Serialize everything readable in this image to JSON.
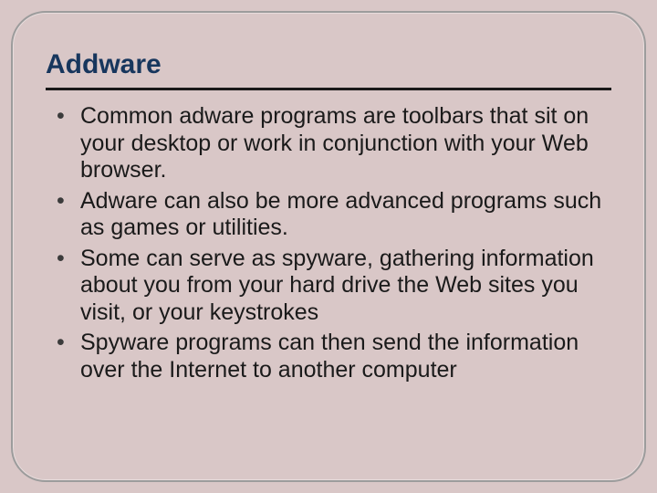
{
  "slide": {
    "title": "Addware",
    "bullets": [
      "Common adware programs are toolbars that sit on your desktop or work in conjunction with your Web browser.",
      "Adware can also be more advanced programs such as games or utilities.",
      "Some can serve as spyware, gathering information about you from your hard drive the Web sites you visit, or your keystrokes",
      "Spyware programs can then send the information over the Internet to another computer"
    ]
  }
}
